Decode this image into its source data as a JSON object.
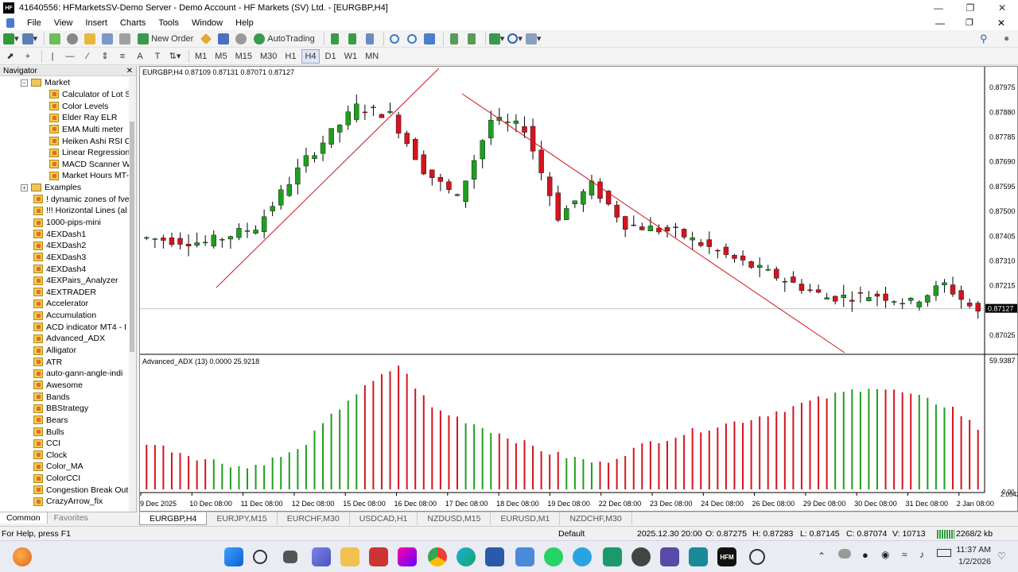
{
  "window": {
    "title": "41640556: HFMarketsSV-Demo Server - Demo Account - HF Markets (SV) Ltd. - [EURGBP,H4]"
  },
  "menu": [
    "File",
    "View",
    "Insert",
    "Charts",
    "Tools",
    "Window",
    "Help"
  ],
  "toolbar": {
    "new_order": "New Order",
    "autotrading": "AutoTrading"
  },
  "timeframes": [
    "M1",
    "M5",
    "M15",
    "M30",
    "H1",
    "H4",
    "D1",
    "W1",
    "MN"
  ],
  "active_timeframe": "H4",
  "navigator": {
    "title": "Navigator",
    "items": [
      {
        "label": "Market",
        "type": "folder-open"
      },
      {
        "label": "Calculator of Lot S",
        "type": "indicator"
      },
      {
        "label": "Color Levels",
        "type": "indicator"
      },
      {
        "label": "Elder Ray ELR",
        "type": "indicator"
      },
      {
        "label": "EMA Multi meter",
        "type": "indicator"
      },
      {
        "label": "Heiken Ashi RSI C",
        "type": "indicator"
      },
      {
        "label": "Linear Regression",
        "type": "indicator"
      },
      {
        "label": "MACD Scanner W",
        "type": "indicator"
      },
      {
        "label": "Market Hours MT-",
        "type": "indicator"
      },
      {
        "label": "Examples",
        "type": "folder"
      },
      {
        "label": "! dynamic zones of fve",
        "type": "indicator-top"
      },
      {
        "label": "!!! Horizontal Lines (al",
        "type": "indicator-top"
      },
      {
        "label": "1000-pips-mini",
        "type": "indicator-top"
      },
      {
        "label": "4EXDash1",
        "type": "indicator-top"
      },
      {
        "label": "4EXDash2",
        "type": "indicator-top"
      },
      {
        "label": "4EXDash3",
        "type": "indicator-top"
      },
      {
        "label": "4EXDash4",
        "type": "indicator-top"
      },
      {
        "label": "4EXPairs_Analyzer",
        "type": "indicator-top"
      },
      {
        "label": "4EXTRADER",
        "type": "indicator-top"
      },
      {
        "label": "Accelerator",
        "type": "indicator-top"
      },
      {
        "label": "Accumulation",
        "type": "indicator-top"
      },
      {
        "label": "ACD indicator MT4 - I",
        "type": "indicator-top"
      },
      {
        "label": "Advanced_ADX",
        "type": "indicator-top"
      },
      {
        "label": "Alligator",
        "type": "indicator-top"
      },
      {
        "label": "ATR",
        "type": "indicator-top"
      },
      {
        "label": "auto-gann-angle-indi",
        "type": "indicator-top"
      },
      {
        "label": "Awesome",
        "type": "indicator-top"
      },
      {
        "label": "Bands",
        "type": "indicator-top"
      },
      {
        "label": "BBStrategy",
        "type": "indicator-top"
      },
      {
        "label": "Bears",
        "type": "indicator-top"
      },
      {
        "label": "Bulls",
        "type": "indicator-top"
      },
      {
        "label": "CCI",
        "type": "indicator-top"
      },
      {
        "label": "Clock",
        "type": "indicator-top"
      },
      {
        "label": "Color_MA",
        "type": "indicator-top"
      },
      {
        "label": "ColorCCI",
        "type": "indicator-top"
      },
      {
        "label": "Congestion Break Out",
        "type": "indicator-top"
      },
      {
        "label": "CrazyArrow_fix",
        "type": "indicator-top"
      }
    ],
    "tabs": [
      "Common",
      "Favorites"
    ]
  },
  "chart": {
    "header": "EURGBP,H4  0.87109 0.87131 0.87071 0.87127",
    "indicator_header": "Advanced_ADX (13) 0.0000 25.9218",
    "price_ticks": [
      "0.87975",
      "0.87880",
      "0.87785",
      "0.87690",
      "0.87595",
      "0.87500",
      "0.87405",
      "0.87310",
      "0.87215",
      "0.87127",
      "0.87025"
    ],
    "current_price": "0.87127",
    "indicator_max": "59.9387",
    "indicator_low": "2.0542",
    "indicator_zero": "0.00",
    "date_ticks": [
      "9 Dec 2025",
      "10 Dec 08:00",
      "11 Dec 08:00",
      "12 Dec 08:00",
      "15 Dec 08:00",
      "16 Dec 08:00",
      "17 Dec 08:00",
      "18 Dec 08:00",
      "19 Dec 08:00",
      "22 Dec 08:00",
      "23 Dec 08:00",
      "24 Dec 08:00",
      "26 Dec 08:00",
      "29 Dec 08:00",
      "30 Dec 08:00",
      "31 Dec 08:00",
      "2 Jan 08:00"
    ],
    "colors": {
      "bull": "#1f9e1f",
      "bear": "#d4141e",
      "trendline": "#d4141e"
    }
  },
  "chart_tabs": [
    "EURGBP,H4",
    "EURJPY,M15",
    "EURCHF,M30",
    "USDCAD,H1",
    "NZDUSD,M15",
    "EURUSD,M1",
    "NZDCHF,M30"
  ],
  "status": {
    "help": "For Help, press F1",
    "profile": "Default",
    "datetime": "2025.12.30 20:00",
    "open": "O: 0.87275",
    "high": "H: 0.87283",
    "low": "L: 0.87145",
    "close": "C: 0.87074",
    "volume": "V: 10713",
    "traffic": "2268/2 kb"
  },
  "taskbar": {
    "time": "11:37 AM",
    "date": "1/2/2026"
  }
}
